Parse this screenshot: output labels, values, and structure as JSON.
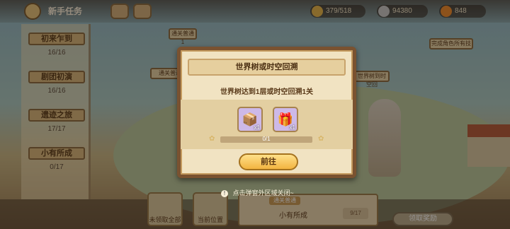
{
  "topbar": {
    "title": "新手任务",
    "resources": [
      {
        "value": "379/518",
        "icon": "stamina-icon",
        "color": "#e8b64a"
      },
      {
        "value": "94380",
        "icon": "coin-icon",
        "color": "#c9c9c9"
      },
      {
        "value": "848",
        "icon": "carrot-icon",
        "color": "#f08a2a"
      }
    ]
  },
  "left_panel": {
    "items": [
      {
        "title": "初来乍到",
        "value": "16/16"
      },
      {
        "title": "剧团初演",
        "value": "16/16"
      },
      {
        "title": "遗迹之旅",
        "value": "17/17"
      },
      {
        "title": "小有所成",
        "value": "0/17"
      }
    ]
  },
  "background": {
    "sign1": "通关普通1",
    "sign2": "通关普通",
    "sign3": "世界树到时空回",
    "sign4": "完成角色所有技"
  },
  "dialog": {
    "title": "世界树或时空回溯",
    "description": "世界树达到1层或时空回溯1关",
    "rewards": [
      {
        "icon": "treasure-chest-icon",
        "count": "x1",
        "color": "#cdb9e8"
      },
      {
        "icon": "gift-box-icon",
        "count": "x1",
        "color": "#cdb9e8"
      }
    ],
    "progress_text": "0/1",
    "progress_fraction": 0,
    "go_button": "前往"
  },
  "hint": "点击弹窗外区域关闭~",
  "bottom": {
    "btn1": "未领取全部",
    "btn2": "当前位置",
    "card_tag": "通关普通",
    "card_name": "小有所成",
    "card_progress": "9/17",
    "claim_button": "领取奖励"
  }
}
